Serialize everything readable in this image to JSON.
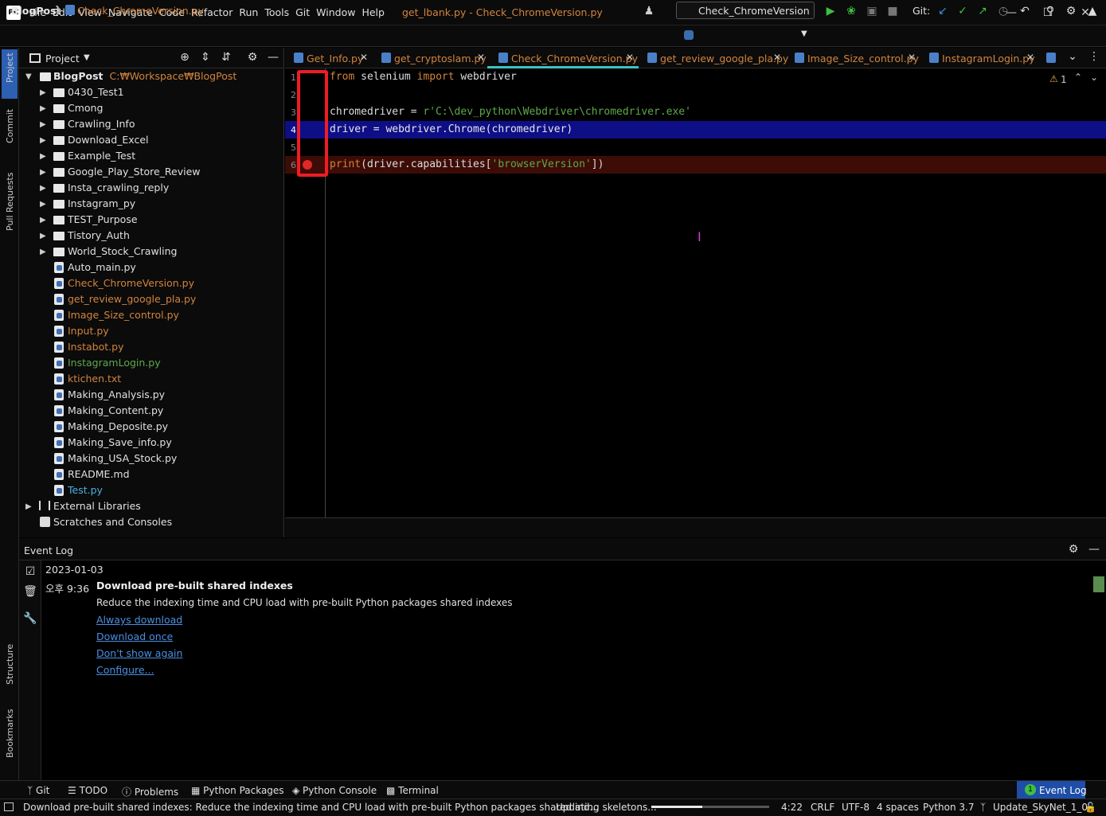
{
  "menu": [
    "File",
    "Edit",
    "View",
    "Navigate",
    "Code",
    "Refactor",
    "Run",
    "Tools",
    "Git",
    "Window",
    "Help"
  ],
  "window_title": "get_lbank.py - Check_ChromeVersion.py",
  "app_logo": "PC",
  "navbar": {
    "project": "BlogPost",
    "file": "Check_ChromeVersion.py",
    "run_config": "Check_ChromeVersion",
    "git_label": "Git:"
  },
  "left_stripe": [
    "Project",
    "Commit",
    "Pull Requests",
    "Structure",
    "Bookmarks"
  ],
  "project_panel": {
    "title": "Project",
    "root": {
      "name": "BlogPost",
      "path": "C:₩Workspace₩BlogPost"
    },
    "folders": [
      "0430_Test1",
      "Cmong",
      "Crawling_Info",
      "Download_Excel",
      "Example_Test",
      "Google_Play_Store_Review",
      "Insta_crawling_reply",
      "Instagram_py",
      "TEST_Purpose",
      "Tistory_Auth",
      "World_Stock_Crawling"
    ],
    "files": [
      {
        "name": "Auto_main.py",
        "color": "#e0e0e0"
      },
      {
        "name": "Check_ChromeVersion.py",
        "color": "#d2843c"
      },
      {
        "name": "get_review_google_pla.py",
        "color": "#d2843c"
      },
      {
        "name": "Image_Size_control.py",
        "color": "#d2843c"
      },
      {
        "name": "Input.py",
        "color": "#d2843c"
      },
      {
        "name": "Instabot.py",
        "color": "#d2843c"
      },
      {
        "name": "InstagramLogin.py",
        "color": "#5fa84b"
      },
      {
        "name": "ktichen.txt",
        "color": "#d2843c"
      },
      {
        "name": "Making_Analysis.py",
        "color": "#e0e0e0"
      },
      {
        "name": "Making_Content.py",
        "color": "#e0e0e0"
      },
      {
        "name": "Making_Deposite.py",
        "color": "#e0e0e0"
      },
      {
        "name": "Making_Save_info.py",
        "color": "#e0e0e0"
      },
      {
        "name": "Making_USA_Stock.py",
        "color": "#e0e0e0"
      },
      {
        "name": "README.md",
        "color": "#e0e0e0"
      },
      {
        "name": "Test.py",
        "color": "#4ab0e0"
      }
    ],
    "external": "External Libraries",
    "scratches": "Scratches and Consoles"
  },
  "tabs": [
    {
      "label": "Get_Info.py",
      "active": false
    },
    {
      "label": "get_cryptoslam.py",
      "active": false
    },
    {
      "label": "Check_ChromeVersion.py",
      "active": true
    },
    {
      "label": "get_review_google_pla.py",
      "active": false
    },
    {
      "label": "Image_Size_control.py",
      "active": false
    },
    {
      "label": "InstagramLogin.py",
      "active": false
    }
  ],
  "editor": {
    "line_numbers": [
      "1",
      "2",
      "3",
      "4",
      "5",
      "6"
    ],
    "warning_count": "1"
  },
  "event_log": {
    "title": "Event Log",
    "date": "2023-01-03",
    "time": "오후 9:36",
    "heading": "Download pre-built shared indexes",
    "message": "Reduce the indexing time and CPU load with pre-built Python packages shared indexes",
    "links": [
      "Always download",
      "Download once",
      "Don't show again",
      "Configure..."
    ]
  },
  "bottom_tools": [
    "Git",
    "TODO",
    "Problems",
    "Python Packages",
    "Python Console",
    "Terminal"
  ],
  "event_log_tab": {
    "badge": "1",
    "label": "Event Log"
  },
  "status": {
    "message": "Download pre-built shared indexes: Reduce the indexing time and CPU load with pre-built Python packages shared ind...",
    "task": "Updating skeletons...",
    "progress": 0.43,
    "position": "4:22",
    "line_sep": "CRLF",
    "encoding": "UTF-8",
    "indent": "4 spaces",
    "interpreter": "Python 3.7",
    "branch": "Update_SkyNet_1_0"
  }
}
